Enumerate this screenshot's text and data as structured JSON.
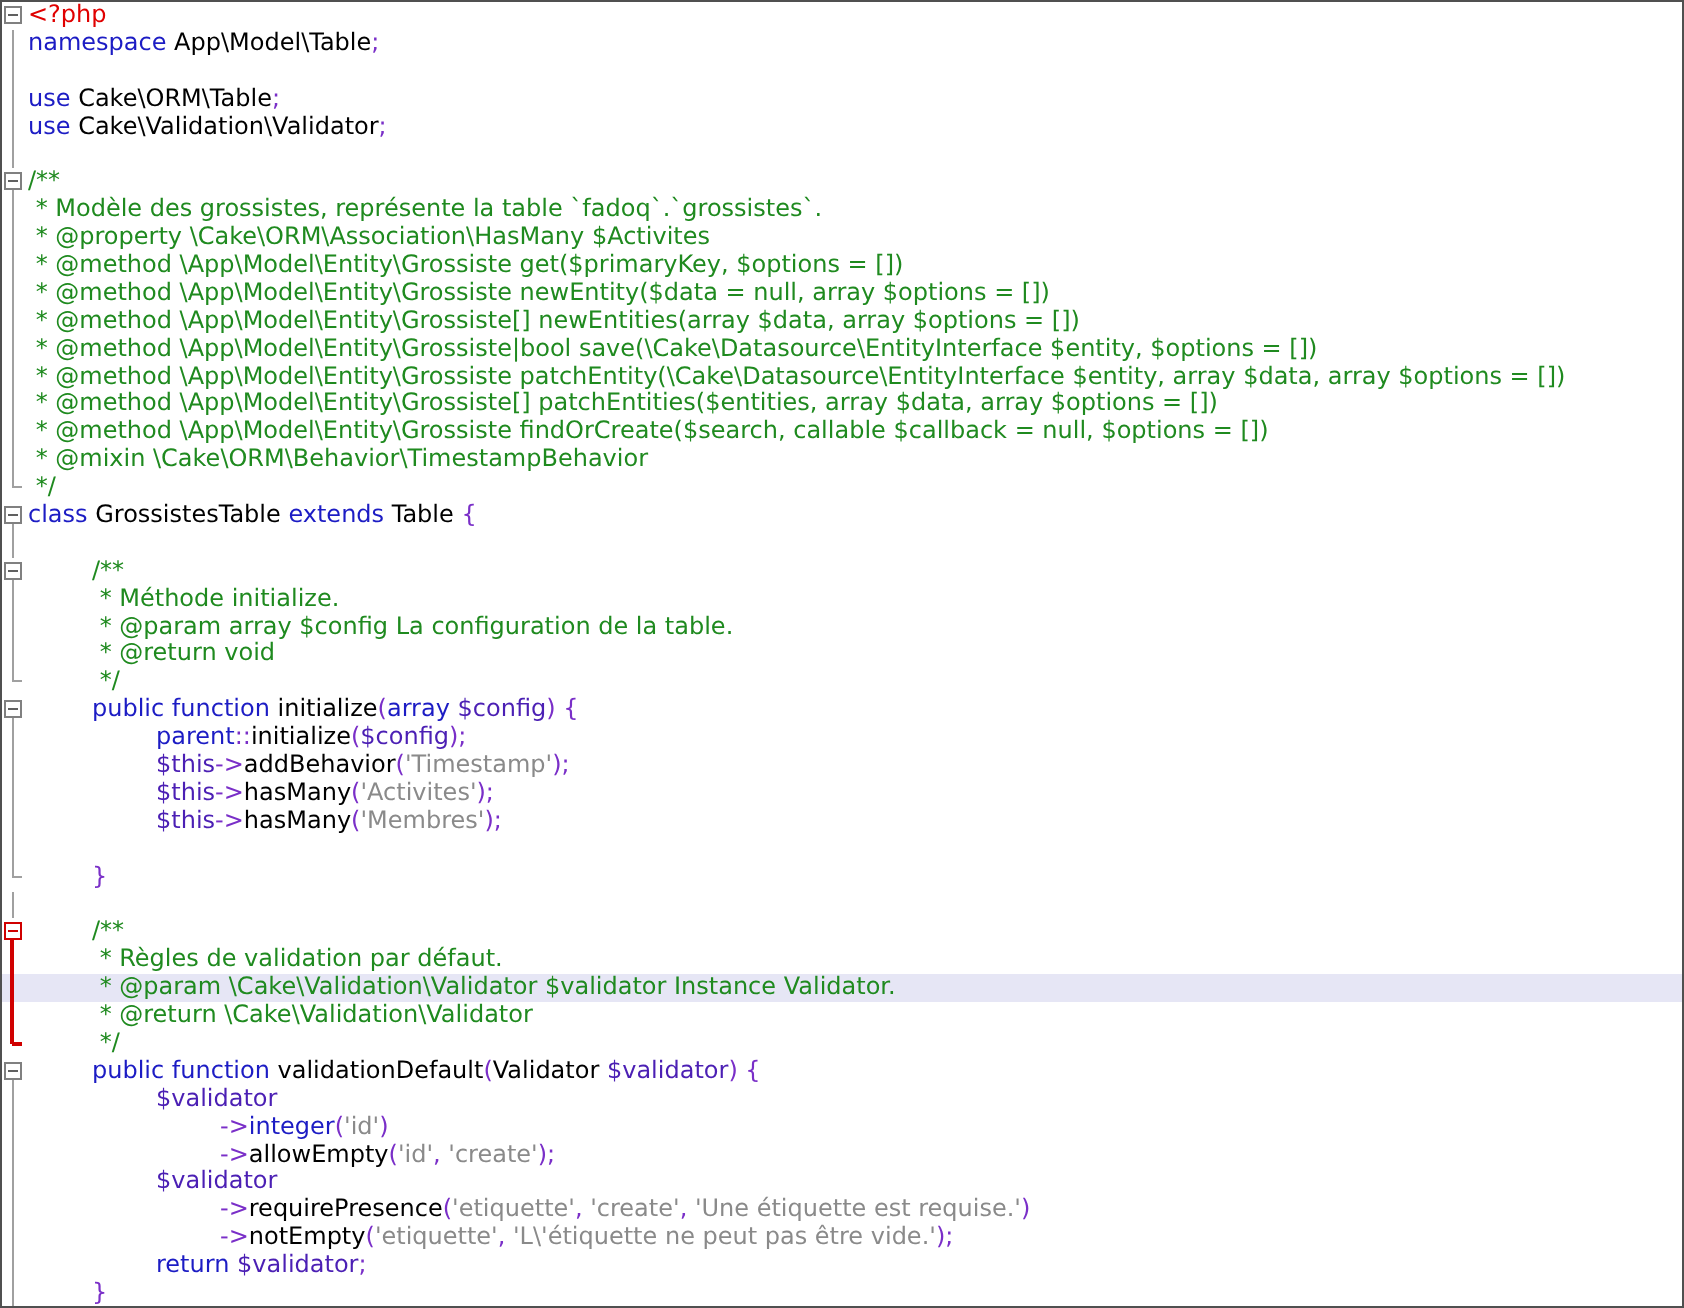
{
  "editor": {
    "lines": [
      {
        "kind": "fold-start",
        "current": false,
        "tokens": [
          {
            "kind": "tag",
            "text": "<?php"
          }
        ]
      },
      {
        "kind": "line",
        "current": false,
        "tokens": [
          {
            "kind": "keyword",
            "text": "namespace"
          },
          {
            "kind": "plain",
            "text": " App\\Model\\Table"
          },
          {
            "kind": "operator",
            "text": ";"
          }
        ]
      },
      {
        "kind": "line",
        "current": false
      },
      {
        "kind": "line",
        "current": false,
        "tokens": [
          {
            "kind": "keyword",
            "text": "use"
          },
          {
            "kind": "plain",
            "text": " Cake\\ORM\\Table"
          },
          {
            "kind": "operator",
            "text": ";"
          }
        ]
      },
      {
        "kind": "line",
        "current": false,
        "tokens": [
          {
            "kind": "keyword",
            "text": "use"
          },
          {
            "kind": "plain",
            "text": " Cake\\Validation\\Validator"
          },
          {
            "kind": "operator",
            "text": ";"
          }
        ]
      },
      {
        "kind": "line",
        "current": false
      },
      {
        "kind": "fold-start",
        "current": false,
        "tokens": [
          {
            "kind": "comment",
            "text": "/**"
          }
        ]
      },
      {
        "kind": "line",
        "current": false,
        "tokens": [
          {
            "kind": "comment",
            "text": " * Modèle des grossistes, représente la table `fadoq`.`grossistes`."
          }
        ]
      },
      {
        "kind": "line",
        "current": false,
        "tokens": [
          {
            "kind": "comment",
            "text": " * @property \\Cake\\ORM\\Association\\HasMany $Activites"
          }
        ]
      },
      {
        "kind": "line",
        "current": false,
        "tokens": [
          {
            "kind": "comment",
            "text": " * @method \\App\\Model\\Entity\\Grossiste get($primaryKey, $options = [])"
          }
        ]
      },
      {
        "kind": "line",
        "current": false,
        "tokens": [
          {
            "kind": "comment",
            "text": " * @method \\App\\Model\\Entity\\Grossiste newEntity($data = null, array $options = [])"
          }
        ]
      },
      {
        "kind": "line",
        "current": false,
        "tokens": [
          {
            "kind": "comment",
            "text": " * @method \\App\\Model\\Entity\\Grossiste[] newEntities(array $data, array $options = [])"
          }
        ]
      },
      {
        "kind": "line",
        "current": false,
        "tokens": [
          {
            "kind": "comment",
            "text": " * @method \\App\\Model\\Entity\\Grossiste|bool save(\\Cake\\Datasource\\EntityInterface $entity, $options = [])"
          }
        ]
      },
      {
        "kind": "line",
        "current": false,
        "tokens": [
          {
            "kind": "comment",
            "text": " * @method \\App\\Model\\Entity\\Grossiste patchEntity(\\Cake\\Datasource\\EntityInterface $entity, array $data, array $options = [])"
          }
        ]
      },
      {
        "kind": "line",
        "current": false,
        "tokens": [
          {
            "kind": "comment",
            "text": " * @method \\App\\Model\\Entity\\Grossiste[] patchEntities($entities, array $data, array $options = [])"
          }
        ]
      },
      {
        "kind": "line",
        "current": false,
        "tokens": [
          {
            "kind": "comment",
            "text": " * @method \\App\\Model\\Entity\\Grossiste findOrCreate($search, callable $callback = null, $options = [])"
          }
        ]
      },
      {
        "kind": "line",
        "current": false,
        "tokens": [
          {
            "kind": "comment",
            "text": " * @mixin \\Cake\\ORM\\Behavior\\TimestampBehavior"
          }
        ]
      },
      {
        "kind": "fold-end",
        "current": false,
        "tokens": [
          {
            "kind": "comment",
            "text": " */"
          }
        ]
      },
      {
        "kind": "fold-start",
        "current": false,
        "tokens": [
          {
            "kind": "keyword",
            "text": "class"
          },
          {
            "kind": "plain",
            "text": " GrossistesTable "
          },
          {
            "kind": "keyword",
            "text": "extends"
          },
          {
            "kind": "plain",
            "text": " Table "
          },
          {
            "kind": "operator",
            "text": "{"
          }
        ]
      },
      {
        "kind": "line",
        "current": false
      },
      {
        "kind": "fold-start",
        "current": false,
        "tokens": [
          {
            "kind": "comment",
            "text": "\t/**"
          }
        ]
      },
      {
        "kind": "line",
        "current": false,
        "tokens": [
          {
            "kind": "comment",
            "text": "\t * Méthode initialize."
          }
        ]
      },
      {
        "kind": "line",
        "current": false,
        "tokens": [
          {
            "kind": "comment",
            "text": "\t * @param array $config La configuration de la table."
          }
        ]
      },
      {
        "kind": "line",
        "current": false,
        "tokens": [
          {
            "kind": "comment",
            "text": "\t * @return void"
          }
        ]
      },
      {
        "kind": "fold-end",
        "current": false,
        "tokens": [
          {
            "kind": "comment",
            "text": "\t */"
          }
        ]
      },
      {
        "kind": "fold-start",
        "current": false,
        "tokens": [
          {
            "kind": "keyword",
            "text": "\tpublic function"
          },
          {
            "kind": "plain",
            "text": " initialize"
          },
          {
            "kind": "operator",
            "text": "("
          },
          {
            "kind": "keyword",
            "text": "array"
          },
          {
            "kind": "variable",
            "text": " $config"
          },
          {
            "kind": "operator",
            "text": ") {"
          }
        ]
      },
      {
        "kind": "line",
        "current": false,
        "tokens": [
          {
            "kind": "keyword",
            "text": "\t\tparent"
          },
          {
            "kind": "operator",
            "text": "::"
          },
          {
            "kind": "plain",
            "text": "initialize"
          },
          {
            "kind": "operator",
            "text": "("
          },
          {
            "kind": "variable",
            "text": "$config"
          },
          {
            "kind": "operator",
            "text": ");"
          }
        ]
      },
      {
        "kind": "line",
        "current": false,
        "tokens": [
          {
            "kind": "variable",
            "text": "\t\t$this"
          },
          {
            "kind": "operator",
            "text": "->"
          },
          {
            "kind": "plain",
            "text": "addBehavior"
          },
          {
            "kind": "operator",
            "text": "("
          },
          {
            "kind": "string",
            "text": "'Timestamp'"
          },
          {
            "kind": "operator",
            "text": ");"
          }
        ]
      },
      {
        "kind": "line",
        "current": false,
        "tokens": [
          {
            "kind": "variable",
            "text": "\t\t$this"
          },
          {
            "kind": "operator",
            "text": "->"
          },
          {
            "kind": "plain",
            "text": "hasMany"
          },
          {
            "kind": "operator",
            "text": "("
          },
          {
            "kind": "string",
            "text": "'Activites'"
          },
          {
            "kind": "operator",
            "text": ");"
          }
        ]
      },
      {
        "kind": "line",
        "current": false,
        "tokens": [
          {
            "kind": "variable",
            "text": "\t\t$this"
          },
          {
            "kind": "operator",
            "text": "->"
          },
          {
            "kind": "plain",
            "text": "hasMany"
          },
          {
            "kind": "operator",
            "text": "("
          },
          {
            "kind": "string",
            "text": "'Membres'"
          },
          {
            "kind": "operator",
            "text": ");"
          }
        ]
      },
      {
        "kind": "line",
        "current": false
      },
      {
        "kind": "fold-end",
        "current": false,
        "tokens": [
          {
            "kind": "operator",
            "text": "\t}"
          }
        ]
      },
      {
        "kind": "line",
        "current": false
      },
      {
        "kind": "active-fold-start",
        "current": false,
        "tokens": [
          {
            "kind": "comment",
            "text": "\t/**"
          }
        ]
      },
      {
        "kind": "active-fold-inside",
        "current": false,
        "tokens": [
          {
            "kind": "comment",
            "text": "\t * Règles de validation par défaut."
          }
        ]
      },
      {
        "kind": "active-fold-inside",
        "current": true,
        "tokens": [
          {
            "kind": "comment",
            "text": "\t * @param \\Cake\\Validation\\Validator $validator Instance Validator."
          }
        ]
      },
      {
        "kind": "active-fold-inside",
        "current": false,
        "tokens": [
          {
            "kind": "comment",
            "text": "\t * @return \\Cake\\Validation\\Validator"
          }
        ]
      },
      {
        "kind": "active-fold-end",
        "current": false,
        "tokens": [
          {
            "kind": "comment",
            "text": "\t */"
          }
        ]
      },
      {
        "kind": "fold-start",
        "current": false,
        "tokens": [
          {
            "kind": "keyword",
            "text": "\tpublic function"
          },
          {
            "kind": "plain",
            "text": " validationDefault"
          },
          {
            "kind": "operator",
            "text": "("
          },
          {
            "kind": "plain",
            "text": "Validator "
          },
          {
            "kind": "variable",
            "text": "$validator"
          },
          {
            "kind": "operator",
            "text": ") {"
          }
        ]
      },
      {
        "kind": "line",
        "current": false,
        "tokens": [
          {
            "kind": "variable",
            "text": "\t\t$validator"
          }
        ]
      },
      {
        "kind": "line",
        "current": false,
        "tokens": [
          {
            "kind": "operator",
            "text": "\t\t\t->"
          },
          {
            "kind": "keyword",
            "text": "integer"
          },
          {
            "kind": "operator",
            "text": "("
          },
          {
            "kind": "string",
            "text": "'id'"
          },
          {
            "kind": "operator",
            "text": ")"
          }
        ]
      },
      {
        "kind": "line",
        "current": false,
        "tokens": [
          {
            "kind": "operator",
            "text": "\t\t\t->"
          },
          {
            "kind": "plain",
            "text": "allowEmpty"
          },
          {
            "kind": "operator",
            "text": "("
          },
          {
            "kind": "string",
            "text": "'id'"
          },
          {
            "kind": "operator",
            "text": ", "
          },
          {
            "kind": "string",
            "text": "'create'"
          },
          {
            "kind": "operator",
            "text": ");"
          }
        ]
      },
      {
        "kind": "line",
        "current": false,
        "tokens": [
          {
            "kind": "variable",
            "text": "\t\t$validator"
          }
        ]
      },
      {
        "kind": "line",
        "current": false,
        "tokens": [
          {
            "kind": "operator",
            "text": "\t\t\t->"
          },
          {
            "kind": "plain",
            "text": "requirePresence"
          },
          {
            "kind": "operator",
            "text": "("
          },
          {
            "kind": "string",
            "text": "'etiquette'"
          },
          {
            "kind": "operator",
            "text": ", "
          },
          {
            "kind": "string",
            "text": "'create'"
          },
          {
            "kind": "operator",
            "text": ", "
          },
          {
            "kind": "string",
            "text": "'Une étiquette est requise.'"
          },
          {
            "kind": "operator",
            "text": ")"
          }
        ]
      },
      {
        "kind": "line",
        "current": false,
        "tokens": [
          {
            "kind": "operator",
            "text": "\t\t\t->"
          },
          {
            "kind": "plain",
            "text": "notEmpty"
          },
          {
            "kind": "operator",
            "text": "("
          },
          {
            "kind": "string",
            "text": "'etiquette'"
          },
          {
            "kind": "operator",
            "text": ", "
          },
          {
            "kind": "string",
            "text": "'L\\'étiquette ne peut pas être vide.'"
          },
          {
            "kind": "operator",
            "text": ");"
          }
        ]
      },
      {
        "kind": "line",
        "current": false,
        "tokens": [
          {
            "kind": "keyword",
            "text": "\t\treturn"
          },
          {
            "kind": "variable",
            "text": " $validator"
          },
          {
            "kind": "operator",
            "text": ";"
          }
        ]
      },
      {
        "kind": "line",
        "current": false,
        "tokens": [
          {
            "kind": "operator",
            "text": "\t}"
          }
        ]
      }
    ]
  }
}
